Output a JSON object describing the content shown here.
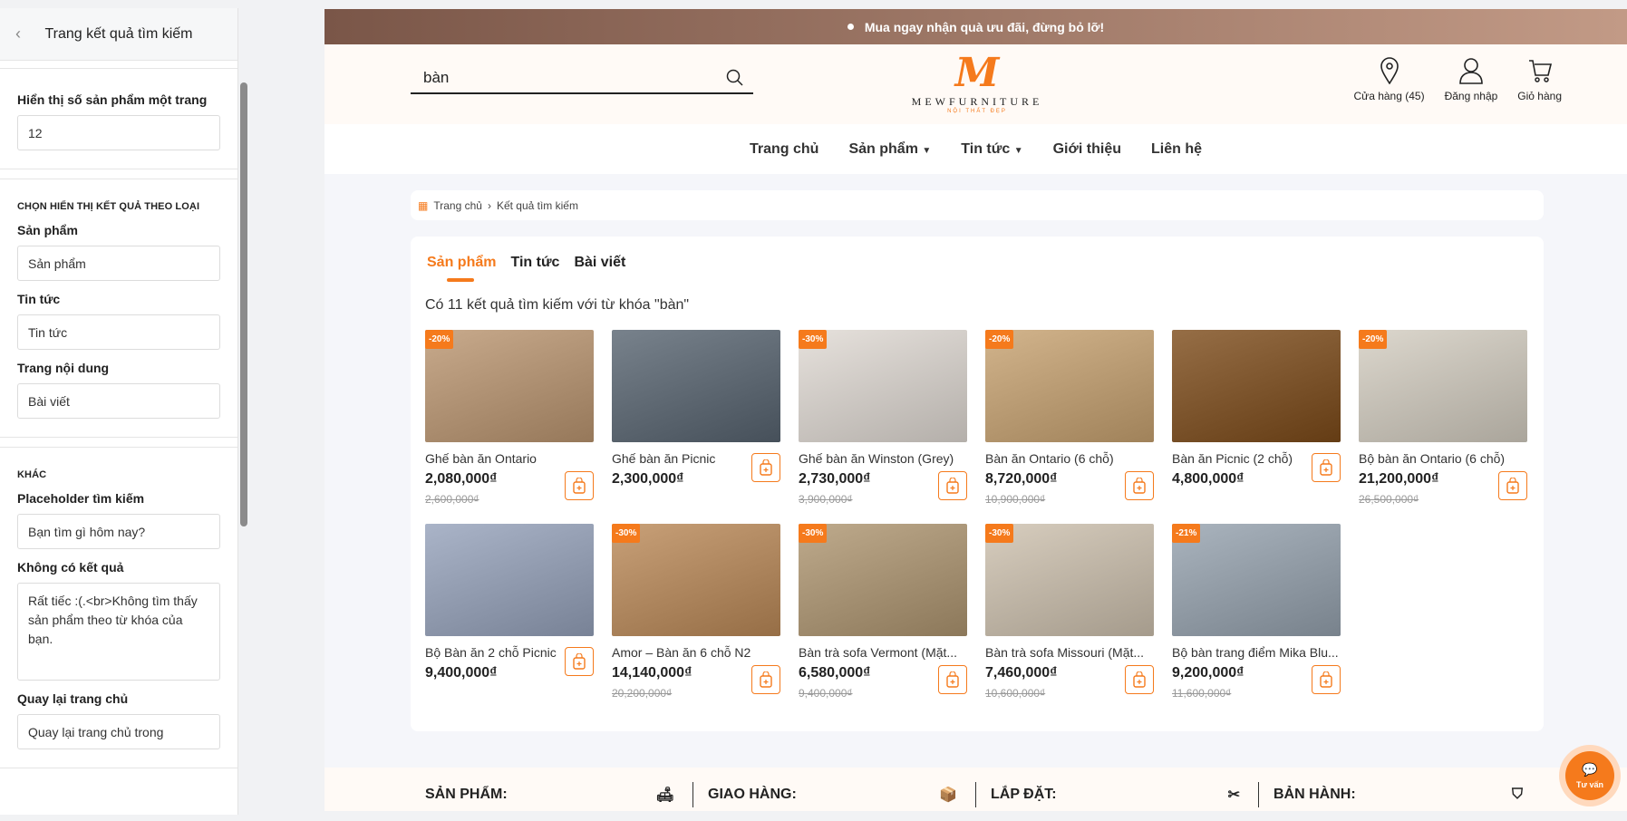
{
  "panel": {
    "title": "Trang kết quả tìm kiếm",
    "per_page_label": "Hiển thị số sản phẩm một trang",
    "per_page_value": "12",
    "type_section": "CHỌN HIỂN THỊ KẾT QUẢ THEO LOẠI",
    "products_label": "Sản phẩm",
    "products_value": "Sản phẩm",
    "news_label": "Tin tức",
    "news_value": "Tin tức",
    "content_label": "Trang nội dung",
    "content_value": "Bài viết",
    "other_section": "KHÁC",
    "placeholder_label": "Placeholder tìm kiếm",
    "placeholder_value": "Bạn tìm gì hôm nay?",
    "noresult_label": "Không có kết quả",
    "noresult_value": "Rất tiếc :(.<br>Không tìm thấy sản phẩm theo từ khóa của bạn.",
    "home_label": "Quay lại trang chủ",
    "home_value": "Quay lại trang chủ trong"
  },
  "site": {
    "banner": "Mua ngay nhận quà ưu đãi, đừng bỏ lỡ!",
    "search_value": "bàn",
    "logo_mark": "M",
    "logo_name": "MEWFURNITURE",
    "logo_tagline": "NỘI THẤT ĐẸP",
    "stores": "Cửa hàng (45)",
    "login": "Đăng nhập",
    "cart": "Giỏ hàng",
    "nav": [
      "Trang chủ",
      "Sản phẩm",
      "Tin tức",
      "Giới thiệu",
      "Liên hệ"
    ],
    "breadcrumb": [
      "Trang chủ",
      "Kết quả tìm kiếm"
    ],
    "tabs": [
      "Sản phẩm",
      "Tin tức",
      "Bài viết"
    ],
    "result_count": "Có 11 kết quả tìm kiếm với từ khóa \"bàn\"",
    "accent": "#f57a1c",
    "products": [
      {
        "name": "Ghế bàn ăn Ontario",
        "price": "2,080,000₫",
        "old": "2,600,000₫",
        "badge": "-20%"
      },
      {
        "name": "Ghế bàn ăn Picnic",
        "price": "2,300,000₫",
        "old": "",
        "badge": ""
      },
      {
        "name": "Ghế bàn ăn Winston (Grey)",
        "price": "2,730,000₫",
        "old": "3,900,000₫",
        "badge": "-30%"
      },
      {
        "name": "Bàn ăn Ontario (6 chỗ)",
        "price": "8,720,000₫",
        "old": "10,900,000₫",
        "badge": "-20%"
      },
      {
        "name": "Bàn ăn Picnic (2 chỗ)",
        "price": "4,800,000₫",
        "old": "",
        "badge": ""
      },
      {
        "name": "Bộ bàn ăn Ontario (6 chỗ)",
        "price": "21,200,000₫",
        "old": "26,500,000₫",
        "badge": "-20%"
      },
      {
        "name": "Bộ Bàn ăn 2 chỗ Picnic",
        "price": "9,400,000₫",
        "old": "",
        "badge": ""
      },
      {
        "name": "Amor – Bàn ăn 6 chỗ N2",
        "price": "14,140,000₫",
        "old": "20,200,000₫",
        "badge": "-30%"
      },
      {
        "name": "Bàn trà sofa Vermont (Mặt...",
        "price": "6,580,000₫",
        "old": "9,400,000₫",
        "badge": "-30%"
      },
      {
        "name": "Bàn trà sofa Missouri (Mặt...",
        "price": "7,460,000₫",
        "old": "10,600,000₫",
        "badge": "-30%"
      },
      {
        "name": "Bộ bàn trang điểm Mika Blu...",
        "price": "9,200,000₫",
        "old": "11,600,000₫",
        "badge": "-21%"
      }
    ],
    "footer": [
      "SẢN PHẨM:",
      "GIAO HÀNG:",
      "LẮP ĐẶT:",
      "BẢN HÀNH:"
    ],
    "chat": "Tư vấn"
  }
}
